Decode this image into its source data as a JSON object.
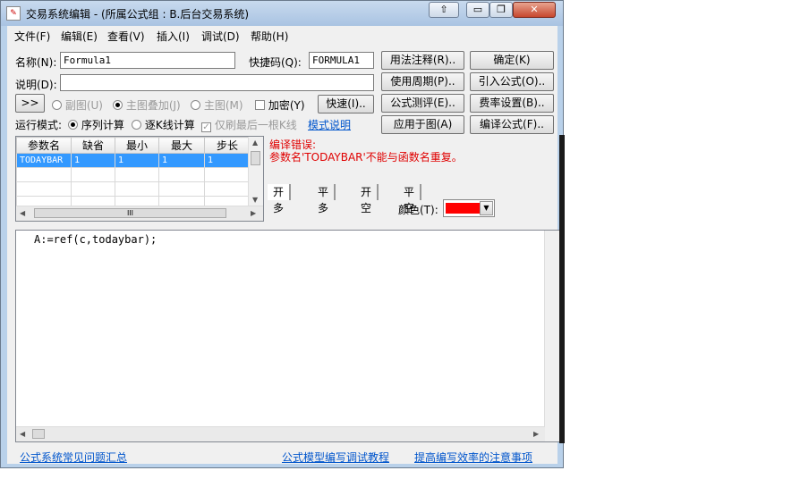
{
  "window": {
    "title": "交易系统编辑 - (所属公式组 : B.后台交易系统)",
    "minimize_label": "▭",
    "restore_label": "❐",
    "close_label": "✕",
    "aux_label": "⇧"
  },
  "menu": [
    "文件(F)",
    "编辑(E)",
    "查看(V)",
    "插入(I)",
    "调试(D)",
    "帮助(H)"
  ],
  "form": {
    "name_label": "名称(N):",
    "name_value": "Formula1",
    "shortcut_label": "快捷码(Q):",
    "shortcut_value": "FORMULA1",
    "desc_label": "说明(D):",
    "desc_value": "",
    "expand_label": ">>",
    "subchart_label": "副图(U)",
    "overlay_label": "主图叠加(J)",
    "mainchart_label": "主图(M)",
    "encrypt_label": "加密(Y)",
    "fast_label": "快速(I)..",
    "runmode_label": "运行模式:",
    "sequential_label": "序列计算",
    "perbar_label": "逐K线计算",
    "lastbar_label": "仅刷最后一根K线",
    "mode_help_link": "模式说明"
  },
  "buttons": {
    "usage_note": "用法注释(R)..",
    "ok": "确定(K)",
    "use_period": "使用周期(P)..",
    "import_formula": "引入公式(O)..",
    "formula_test": "公式测评(E)..",
    "fee_settings": "费率设置(B)..",
    "apply_chart": "应用于图(A)",
    "compile": "编译公式(F).."
  },
  "param_table": {
    "headers": [
      "参数名",
      "缺省",
      "最小",
      "最大",
      "步长"
    ],
    "rows": [
      [
        "TODAYBAR",
        "1",
        "1",
        "1",
        "1"
      ],
      [
        "",
        "",
        "",
        "",
        ""
      ],
      [
        "",
        "",
        "",
        "",
        ""
      ],
      [
        "",
        "",
        "",
        "",
        ""
      ]
    ],
    "hscroll_thumb": "III"
  },
  "compile": {
    "error_title": "编译错误:",
    "error_message": "参数名'TODAYBAR'不能与函数名重复。"
  },
  "signal_tabs": [
    "开多",
    "平多",
    "开空",
    "平空"
  ],
  "color": {
    "label": "颜色(T):",
    "value": "#ff0000"
  },
  "editor": {
    "code": "A:=ref(c,todaybar);"
  },
  "footer_links": [
    "公式系统常见问题汇总",
    "公式模型编写调试教程",
    "提高编写效率的注意事项"
  ]
}
